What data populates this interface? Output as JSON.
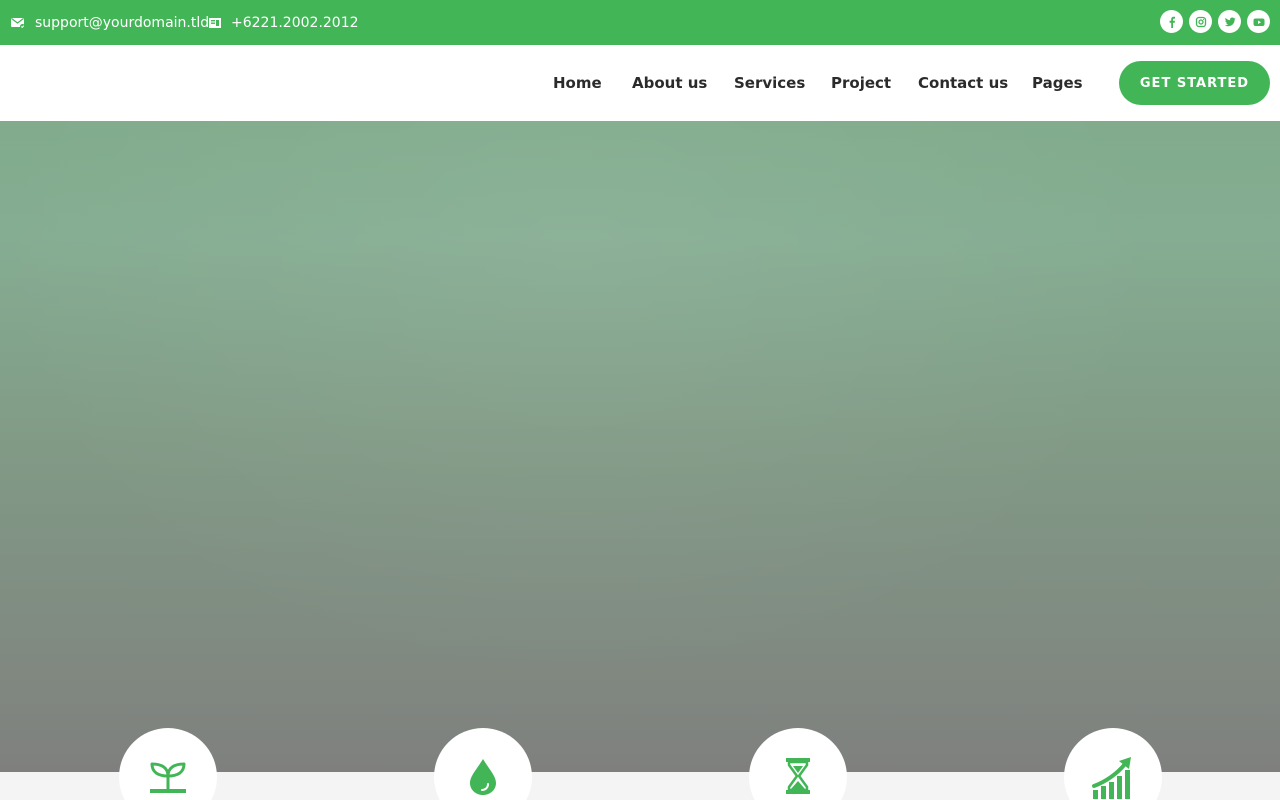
{
  "topbar": {
    "email": "support@yourdomain.tld",
    "email_icon": "mail-check-icon",
    "phone": "+6221.2002.2012",
    "phone_icon": "phone-icon",
    "socials": [
      "facebook-icon",
      "instagram-icon",
      "twitter-icon",
      "youtube-icon"
    ]
  },
  "nav": {
    "items": [
      "Home",
      "About us",
      "Services",
      "Project",
      "Contact us",
      "Pages"
    ],
    "cta_label": "GET STARTED"
  },
  "features": {
    "icons": [
      "sprout-icon",
      "water-drop-icon",
      "hourglass-icon",
      "growth-chart-icon"
    ]
  },
  "colors": {
    "accent": "#42b656",
    "nav_text": "#2b2b2b",
    "page_bg": "#f4f4f4"
  }
}
